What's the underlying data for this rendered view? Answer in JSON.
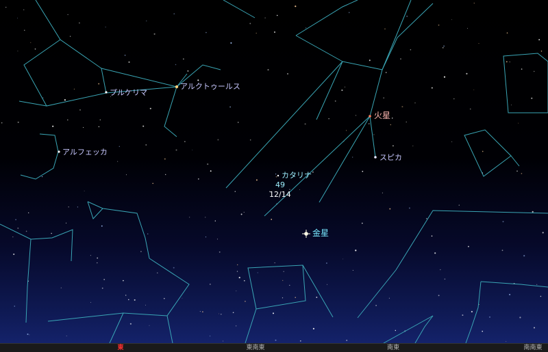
{
  "stars": {
    "arcturus": "アルクトゥールス",
    "pulcherrima": "プルケリマ",
    "alphecca": "アルフェッカ",
    "spica": "スピカ"
  },
  "planets": {
    "mars": "火星",
    "venus": "金星"
  },
  "comet": {
    "name": "カタリナ",
    "magnitude_mark": "49",
    "date": "12/14"
  },
  "horizon": {
    "east": "東",
    "ese": "東南東",
    "se": "南東",
    "sse": "南南東"
  },
  "colors": {
    "constellation_lines": "#3aa6b6",
    "star_label": "#c8c8ff",
    "planet_label": "#78e8ff",
    "mars_label": "#ffb8b0",
    "east_marker": "#ff3030"
  }
}
